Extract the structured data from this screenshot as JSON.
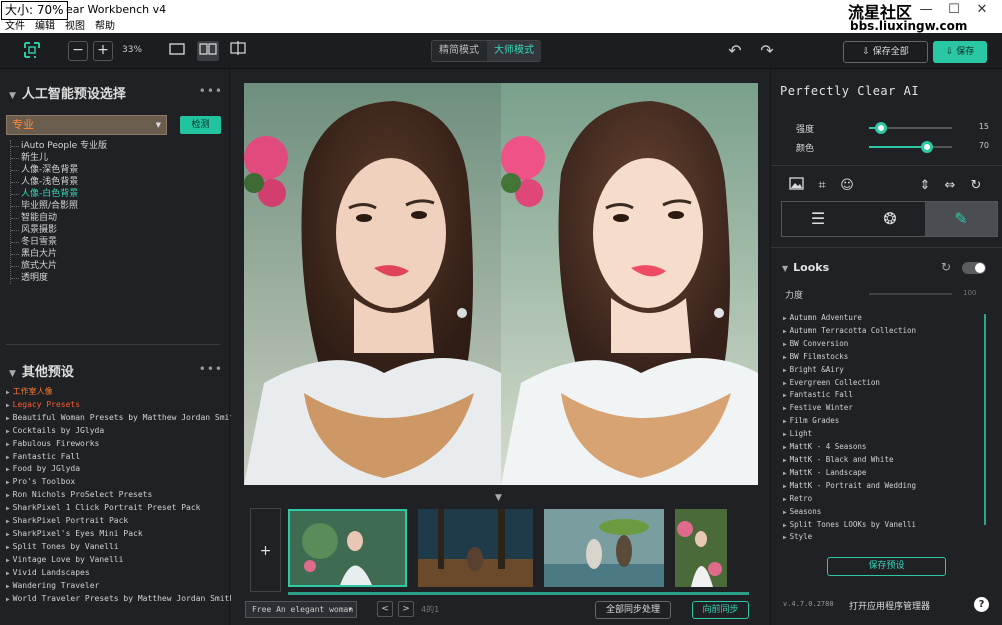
{
  "window": {
    "zoom_tag": "大小: 70%",
    "title": "ear Workbench v4",
    "watermark": "流星社区",
    "watermark2": "bbs.liuxingw.com",
    "controls": [
      "—",
      "☐",
      "✕"
    ]
  },
  "menu": [
    "文件",
    "编辑",
    "视图",
    "帮助"
  ],
  "toolbar": {
    "zoom_out": "−",
    "zoom_in": "+",
    "zoom_value": "33%",
    "modes": [
      "精简模式",
      "大师模式"
    ],
    "active_mode": "大师模式",
    "save_all": "保存全部",
    "save": "保存"
  },
  "left": {
    "ai_title": "人工智能预设选择",
    "preset_value": "专业",
    "detect": "检测",
    "ai_presets": [
      "iAuto People 专业版",
      "新生儿",
      "人像-深色背景",
      "人像-浅色背景",
      "人像-白色背景",
      "毕业照/合影照",
      "智能自动",
      "风景摄影",
      "冬日雪景",
      "黑白大片",
      "旅式大片",
      "透明度"
    ],
    "ai_selected_index": 4,
    "other_title": "其他预设",
    "other_presets": [
      "工作室人像",
      "Legacy Presets",
      "Beautiful Woman Presets by Matthew Jordan Smith",
      "Cocktails by JGlyda",
      "Fabulous Fireworks",
      "Fantastic Fall",
      "Food by JGlyda",
      "Pro's Toolbox",
      "Ron Nichols ProSelect Presets",
      "SharkPixel 1 Click Portrait Preset Pack",
      "SharkPixel Portrait Pack",
      "SharkPixel's Eyes Mini Pack",
      "Split Tones by Vanelli",
      "Vintage Love by Vanelli",
      "Vivid Landscapes",
      "Wandering Traveler",
      "World Traveler Presets by Matthew Jordan Smith"
    ]
  },
  "center": {
    "add": "+",
    "bottom_select": "Free An elegant woman",
    "prev": "<",
    "next": ">",
    "page": "4的1",
    "sync_all": "全部同步处理",
    "sync_forward": "向前同步"
  },
  "right": {
    "title": "Perfectly Clear AI",
    "sliders": [
      {
        "label": "强度",
        "value": 15,
        "max": 100
      },
      {
        "label": "颜色",
        "value": 70,
        "max": 100
      }
    ],
    "looks_title": "Looks",
    "looks_strength_label": "力度",
    "looks_strength_value": "100",
    "looks": [
      "Autumn Adventure",
      "Autumn Terracotta Collection",
      "BW Conversion",
      "BW Filmstocks",
      "Bright &Airy",
      "Evergreen Collection",
      "Fantastic Fall",
      "Festive Winter",
      "Film Grades",
      "Light",
      "MattK - 4 Seasons",
      "MattK - Black and White",
      "MattK - Landscape",
      "MattK - Portrait and Wedding",
      "Retro",
      "Seasons",
      "Split Tones LOOKs by Vanelli",
      "Style"
    ],
    "save_preset": "保存预设",
    "version": "v.4.7.0.2780",
    "open_manager": "打开应用程序管理器",
    "help": "?"
  },
  "colors": {
    "accent": "#2cc9a4",
    "background": "#1f2124",
    "highlight_orange": "#ff7a2e"
  }
}
